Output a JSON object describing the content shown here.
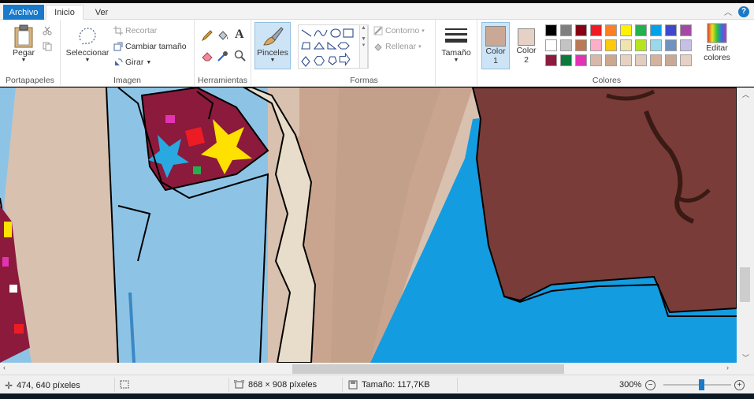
{
  "tabs": {
    "file": "Archivo",
    "home": "Inicio",
    "view": "Ver"
  },
  "ribbon": {
    "clipboard": {
      "group_label": "Portapapeles",
      "paste": "Pegar"
    },
    "image": {
      "group_label": "Imagen",
      "select": "Seleccionar",
      "crop": "Recortar",
      "resize": "Cambiar tamaño",
      "rotate": "Girar"
    },
    "tools": {
      "group_label": "Herramientas"
    },
    "brushes": {
      "label": "Pinceles"
    },
    "shapes": {
      "group_label": "Formas",
      "outline": "Contorno",
      "fill": "Rellenar"
    },
    "size": {
      "label": "Tamaño"
    },
    "colors": {
      "group_label": "Colores",
      "color1_label": "Color",
      "color1_num": "1",
      "color2_label": "Color",
      "color2_num": "2",
      "edit_label": "Editar",
      "edit_label2": "colores",
      "color1_value": "#c9a996",
      "color2_value": "#e6d1c6",
      "palette_row1": [
        "#000000",
        "#7f7f7f",
        "#880015",
        "#ed1c24",
        "#ff7f27",
        "#fff200",
        "#22b14c",
        "#00a2e8",
        "#3f48cc",
        "#a349a4"
      ],
      "palette_row2": [
        "#ffffff",
        "#c3c3c3",
        "#b97a57",
        "#ffaec9",
        "#ffc90e",
        "#efe4b0",
        "#b5e61d",
        "#99d9ea",
        "#7092be",
        "#c8bfe7"
      ],
      "palette_row3": [
        "#8b1a3c",
        "#0b7a3b",
        "#e233b5",
        "#d8b8a8",
        "#cfa78e",
        "#e7d2c2",
        "#e3cdbf",
        "#d4b29c",
        "#c9a996",
        "#e6d1c6"
      ]
    }
  },
  "status": {
    "cursor_pos": "474, 640 píxeles",
    "image_size": "868 × 908 píxeles",
    "file_size": "Tamaño: 117,7KB",
    "zoom": "300%"
  }
}
